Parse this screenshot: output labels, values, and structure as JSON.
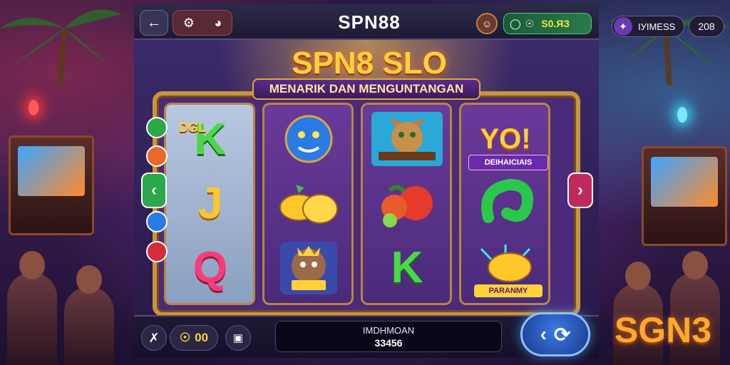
{
  "topbar": {
    "back_icon": "back-arrow-icon",
    "group_icons": [
      "settings-gear-icon",
      "sound-icon"
    ],
    "brand_title": "SPN88",
    "profile_icon": "profile-icon",
    "balance_icon": "wallet-icon",
    "balance_value": "S0.ЯЗ"
  },
  "right_panel": {
    "games_icon": "games-icon",
    "games_label": "ІУІМЕЅЅ",
    "count": "208"
  },
  "game": {
    "logo": "SPN8 SLO",
    "tagline": "MENARIK DAN MENGUNTANGAN",
    "reels": [
      {
        "symbols": [
          {
            "label": "K",
            "badge": "DGL"
          },
          {
            "label": "J"
          },
          {
            "label": "Q"
          }
        ]
      },
      {
        "symbols": [
          {
            "icon": "blue-panther-icon"
          },
          {
            "icon": "golden-fruit-icon"
          },
          {
            "icon": "raccoon-king-icon"
          }
        ]
      },
      {
        "symbols": [
          {
            "icon": "cat-warrior-icon"
          },
          {
            "icon": "fruit-pile-icon"
          },
          {
            "label": "K"
          }
        ]
      },
      {
        "symbols": [
          {
            "label": "YO!",
            "banner": "DEIHAICIAIS"
          },
          {
            "icon": "green-swirl-icon"
          },
          {
            "icon": "gold-mango-icon",
            "banner": "PARANMY"
          }
        ]
      }
    ],
    "side_buttons": [
      "green",
      "orange",
      "green",
      "blue",
      "red"
    ]
  },
  "bottombar": {
    "tools_icon": "tools-icon",
    "bet_value": "00",
    "bet_icon": "coin-icon",
    "info_icon": "info-icon",
    "win_label": "IMDHMOAN",
    "win_amount": "33456",
    "spin_icons": [
      "spin-back-icon",
      "spin-refresh-icon"
    ]
  },
  "brand_corner": "SGN3",
  "colors": {
    "accent_gold": "#ffd23a",
    "frame_gold": "#c8963a",
    "spin_blue": "#3a7ae8",
    "balance_green": "#2a7a4a"
  }
}
